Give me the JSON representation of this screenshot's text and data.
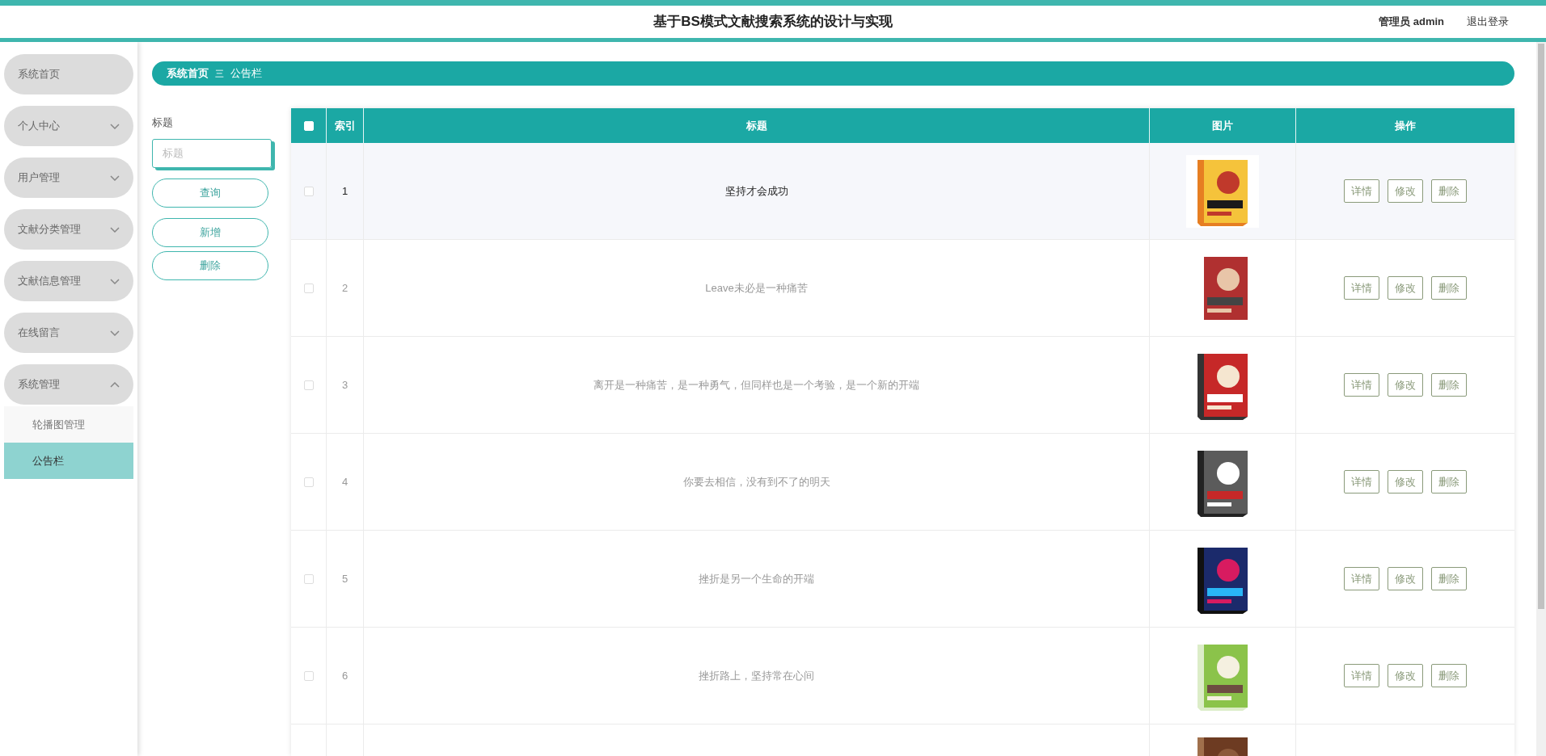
{
  "header": {
    "title": "基于BS模式文献搜索系统的设计与实现",
    "user": "管理员 admin",
    "logout": "退出登录"
  },
  "sidebar": {
    "items": [
      {
        "label": "系统首页",
        "kind": "link"
      },
      {
        "label": "个人中心",
        "kind": "menu",
        "expanded": false
      },
      {
        "label": "用户管理",
        "kind": "menu",
        "expanded": false
      },
      {
        "label": "文献分类管理",
        "kind": "menu",
        "expanded": false
      },
      {
        "label": "文献信息管理",
        "kind": "menu",
        "expanded": false
      },
      {
        "label": "在线留言",
        "kind": "menu",
        "expanded": false
      },
      {
        "label": "系统管理",
        "kind": "menu",
        "expanded": true,
        "children": [
          {
            "label": "轮播图管理",
            "selected": false
          },
          {
            "label": "公告栏",
            "selected": true
          }
        ]
      }
    ]
  },
  "breadcrumb": {
    "home": "系统首页",
    "separator": "三",
    "current": "公告栏"
  },
  "search": {
    "label": "标题",
    "placeholder": "标题",
    "buttons": [
      "查询",
      "新增",
      "删除"
    ]
  },
  "table": {
    "all_checked": false,
    "columns": [
      "索引",
      "标题",
      "图片",
      "操作"
    ],
    "rows": [
      {
        "index": "1",
        "title": "坚持才会成功",
        "hovered": true,
        "checked": false,
        "actions": [
          "详情",
          "修改",
          "删除"
        ]
      },
      {
        "index": "2",
        "title": "Leave未必是一种痛苦",
        "hovered": false,
        "checked": false,
        "actions": [
          "详情",
          "修改",
          "删除"
        ]
      },
      {
        "index": "3",
        "title": "离开是一种痛苦，是一种勇气，但同样也是一个考验，是一个新的开端",
        "hovered": false,
        "checked": false,
        "actions": [
          "详情",
          "修改",
          "删除"
        ]
      },
      {
        "index": "4",
        "title": "你要去相信，没有到不了的明天",
        "hovered": false,
        "checked": false,
        "actions": [
          "详情",
          "修改",
          "删除"
        ]
      },
      {
        "index": "5",
        "title": "挫折是另一个生命的开端",
        "hovered": false,
        "checked": false,
        "actions": [
          "详情",
          "修改",
          "删除"
        ]
      },
      {
        "index": "6",
        "title": "挫折路上，坚持常在心间",
        "hovered": false,
        "checked": false,
        "actions": [
          "详情",
          "修改",
          "删除"
        ]
      }
    ]
  }
}
